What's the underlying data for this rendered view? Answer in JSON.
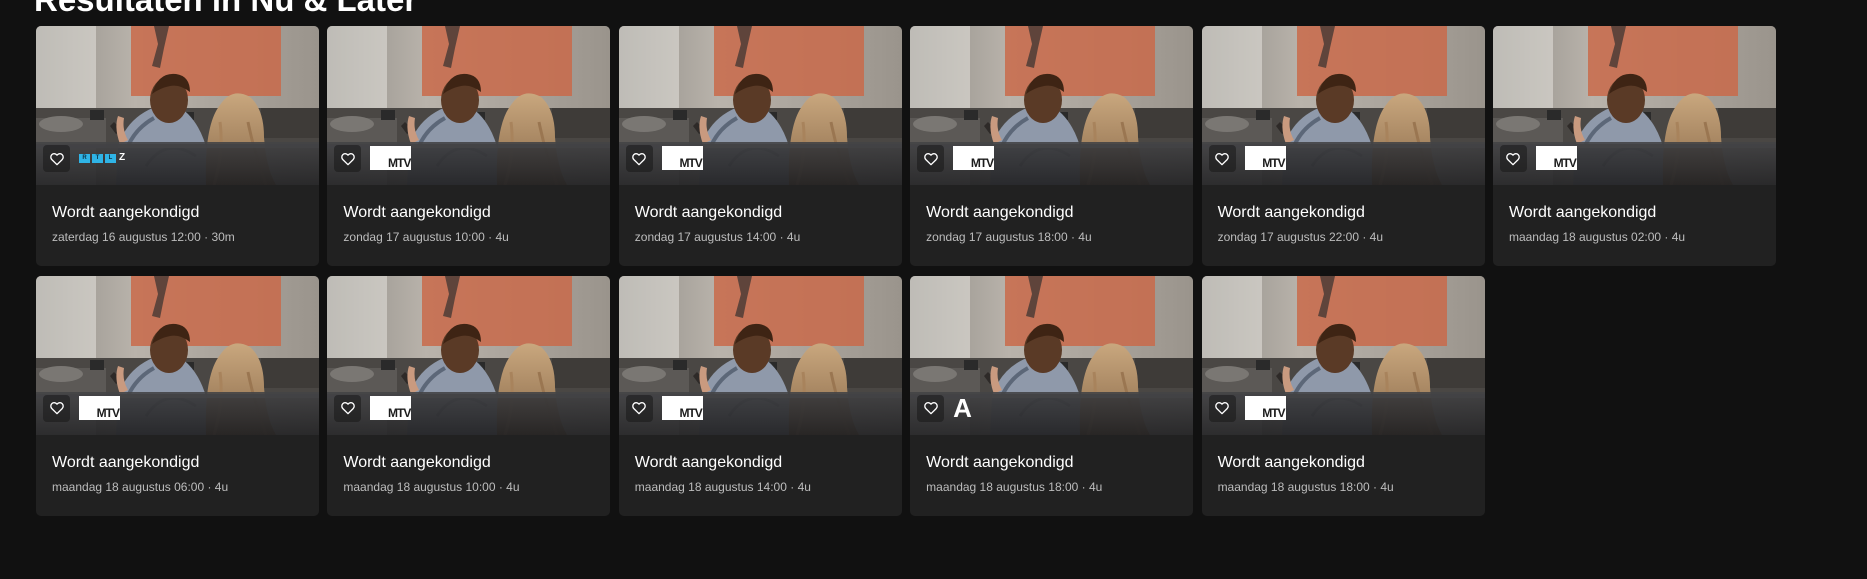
{
  "section": {
    "title": "Resultaten in Nu & Later"
  },
  "icons": {
    "favorite": "heart-outline-icon"
  },
  "colors": {
    "background": "#111111",
    "card": "#212121",
    "text": "#ffffff",
    "meta_text": "#bdbdbd",
    "rtlz_blue": "#2fb4e6"
  },
  "channels": {
    "rtlz": {
      "name": "RTL Z",
      "letters": [
        "R",
        "T",
        "L"
      ],
      "suffix": "Z"
    },
    "mtv": {
      "name": "MTV",
      "text": "MTV"
    },
    "a": {
      "name": "A",
      "text": "A"
    }
  },
  "cards": [
    {
      "title": "Wordt aangekondigd",
      "meta": "zaterdag 16 augustus 12:00 · 30m",
      "channel": "rtlz"
    },
    {
      "title": "Wordt aangekondigd",
      "meta": "zondag 17 augustus 10:00 · 4u",
      "channel": "mtv"
    },
    {
      "title": "Wordt aangekondigd",
      "meta": "zondag 17 augustus 14:00 · 4u",
      "channel": "mtv"
    },
    {
      "title": "Wordt aangekondigd",
      "meta": "zondag 17 augustus 18:00 · 4u",
      "channel": "mtv"
    },
    {
      "title": "Wordt aangekondigd",
      "meta": "zondag 17 augustus 22:00 · 4u",
      "channel": "mtv"
    },
    {
      "title": "Wordt aangekondigd",
      "meta": "maandag 18 augustus 02:00 · 4u",
      "channel": "mtv"
    },
    {
      "title": "Wordt aangekondigd",
      "meta": "maandag 18 augustus 06:00 · 4u",
      "channel": "mtv"
    },
    {
      "title": "Wordt aangekondigd",
      "meta": "maandag 18 augustus 10:00 · 4u",
      "channel": "mtv"
    },
    {
      "title": "Wordt aangekondigd",
      "meta": "maandag 18 augustus 14:00 · 4u",
      "channel": "mtv"
    },
    {
      "title": "Wordt aangekondigd",
      "meta": "maandag 18 augustus 18:00 · 4u",
      "channel": "a"
    },
    {
      "title": "Wordt aangekondigd",
      "meta": "maandag 18 augustus 18:00 · 4u",
      "channel": "mtv"
    }
  ]
}
